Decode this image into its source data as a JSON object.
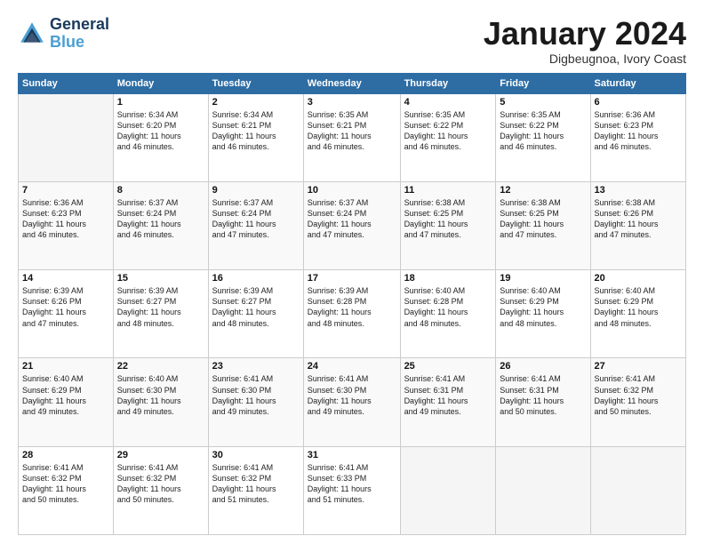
{
  "logo": {
    "line1": "General",
    "line2": "Blue"
  },
  "title": "January 2024",
  "subtitle": "Digbeugnoa, Ivory Coast",
  "days_of_week": [
    "Sunday",
    "Monday",
    "Tuesday",
    "Wednesday",
    "Thursday",
    "Friday",
    "Saturday"
  ],
  "weeks": [
    [
      {
        "num": "",
        "detail": ""
      },
      {
        "num": "1",
        "detail": "Sunrise: 6:34 AM\nSunset: 6:20 PM\nDaylight: 11 hours\nand 46 minutes."
      },
      {
        "num": "2",
        "detail": "Sunrise: 6:34 AM\nSunset: 6:21 PM\nDaylight: 11 hours\nand 46 minutes."
      },
      {
        "num": "3",
        "detail": "Sunrise: 6:35 AM\nSunset: 6:21 PM\nDaylight: 11 hours\nand 46 minutes."
      },
      {
        "num": "4",
        "detail": "Sunrise: 6:35 AM\nSunset: 6:22 PM\nDaylight: 11 hours\nand 46 minutes."
      },
      {
        "num": "5",
        "detail": "Sunrise: 6:35 AM\nSunset: 6:22 PM\nDaylight: 11 hours\nand 46 minutes."
      },
      {
        "num": "6",
        "detail": "Sunrise: 6:36 AM\nSunset: 6:23 PM\nDaylight: 11 hours\nand 46 minutes."
      }
    ],
    [
      {
        "num": "7",
        "detail": "Sunrise: 6:36 AM\nSunset: 6:23 PM\nDaylight: 11 hours\nand 46 minutes."
      },
      {
        "num": "8",
        "detail": "Sunrise: 6:37 AM\nSunset: 6:24 PM\nDaylight: 11 hours\nand 46 minutes."
      },
      {
        "num": "9",
        "detail": "Sunrise: 6:37 AM\nSunset: 6:24 PM\nDaylight: 11 hours\nand 47 minutes."
      },
      {
        "num": "10",
        "detail": "Sunrise: 6:37 AM\nSunset: 6:24 PM\nDaylight: 11 hours\nand 47 minutes."
      },
      {
        "num": "11",
        "detail": "Sunrise: 6:38 AM\nSunset: 6:25 PM\nDaylight: 11 hours\nand 47 minutes."
      },
      {
        "num": "12",
        "detail": "Sunrise: 6:38 AM\nSunset: 6:25 PM\nDaylight: 11 hours\nand 47 minutes."
      },
      {
        "num": "13",
        "detail": "Sunrise: 6:38 AM\nSunset: 6:26 PM\nDaylight: 11 hours\nand 47 minutes."
      }
    ],
    [
      {
        "num": "14",
        "detail": "Sunrise: 6:39 AM\nSunset: 6:26 PM\nDaylight: 11 hours\nand 47 minutes."
      },
      {
        "num": "15",
        "detail": "Sunrise: 6:39 AM\nSunset: 6:27 PM\nDaylight: 11 hours\nand 48 minutes."
      },
      {
        "num": "16",
        "detail": "Sunrise: 6:39 AM\nSunset: 6:27 PM\nDaylight: 11 hours\nand 48 minutes."
      },
      {
        "num": "17",
        "detail": "Sunrise: 6:39 AM\nSunset: 6:28 PM\nDaylight: 11 hours\nand 48 minutes."
      },
      {
        "num": "18",
        "detail": "Sunrise: 6:40 AM\nSunset: 6:28 PM\nDaylight: 11 hours\nand 48 minutes."
      },
      {
        "num": "19",
        "detail": "Sunrise: 6:40 AM\nSunset: 6:29 PM\nDaylight: 11 hours\nand 48 minutes."
      },
      {
        "num": "20",
        "detail": "Sunrise: 6:40 AM\nSunset: 6:29 PM\nDaylight: 11 hours\nand 48 minutes."
      }
    ],
    [
      {
        "num": "21",
        "detail": "Sunrise: 6:40 AM\nSunset: 6:29 PM\nDaylight: 11 hours\nand 49 minutes."
      },
      {
        "num": "22",
        "detail": "Sunrise: 6:40 AM\nSunset: 6:30 PM\nDaylight: 11 hours\nand 49 minutes."
      },
      {
        "num": "23",
        "detail": "Sunrise: 6:41 AM\nSunset: 6:30 PM\nDaylight: 11 hours\nand 49 minutes."
      },
      {
        "num": "24",
        "detail": "Sunrise: 6:41 AM\nSunset: 6:30 PM\nDaylight: 11 hours\nand 49 minutes."
      },
      {
        "num": "25",
        "detail": "Sunrise: 6:41 AM\nSunset: 6:31 PM\nDaylight: 11 hours\nand 49 minutes."
      },
      {
        "num": "26",
        "detail": "Sunrise: 6:41 AM\nSunset: 6:31 PM\nDaylight: 11 hours\nand 50 minutes."
      },
      {
        "num": "27",
        "detail": "Sunrise: 6:41 AM\nSunset: 6:32 PM\nDaylight: 11 hours\nand 50 minutes."
      }
    ],
    [
      {
        "num": "28",
        "detail": "Sunrise: 6:41 AM\nSunset: 6:32 PM\nDaylight: 11 hours\nand 50 minutes."
      },
      {
        "num": "29",
        "detail": "Sunrise: 6:41 AM\nSunset: 6:32 PM\nDaylight: 11 hours\nand 50 minutes."
      },
      {
        "num": "30",
        "detail": "Sunrise: 6:41 AM\nSunset: 6:32 PM\nDaylight: 11 hours\nand 51 minutes."
      },
      {
        "num": "31",
        "detail": "Sunrise: 6:41 AM\nSunset: 6:33 PM\nDaylight: 11 hours\nand 51 minutes."
      },
      {
        "num": "",
        "detail": ""
      },
      {
        "num": "",
        "detail": ""
      },
      {
        "num": "",
        "detail": ""
      }
    ]
  ]
}
